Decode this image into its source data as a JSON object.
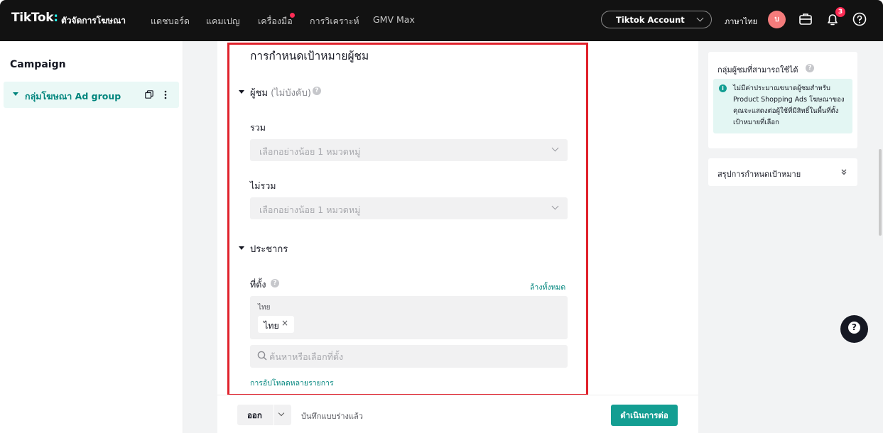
{
  "header": {
    "logo": "TikTok",
    "logo_colon": ":",
    "logo_sub": "ตัวจัดการโฆษณา",
    "nav": [
      "แดชบอร์ด",
      "แคมเปญ",
      "เครื่องมือ",
      "การวิเคราะห์",
      "GMV Max"
    ],
    "account": "Tiktok Account",
    "language": "ภาษาไทย",
    "avatar": "บ",
    "notification_count": "3"
  },
  "sidebar": {
    "title": "Campaign",
    "item_label": "กลุ่มโฆษณา Ad group"
  },
  "form": {
    "section_title": "การกำหนดเป้าหมายผู้ชม",
    "audience_heading": "ผู้ชม",
    "audience_optional": "(ไม่บังคับ)",
    "include_label": "รวม",
    "include_placeholder": "เลือกอย่างน้อย 1 หมวดหมู่",
    "exclude_label": "ไม่รวม",
    "exclude_placeholder": "เลือกอย่างน้อย 1 หมวดหมู่",
    "demographics_heading": "ประชากร",
    "location_label": "ที่ตั้ง",
    "clear_all": "ล้างทั้งหมด",
    "location_group": "ไทย",
    "location_chip": "ไทย",
    "chip_remove": "×",
    "search_placeholder": "ค้นหาหรือเลือกที่ตั้ง",
    "bulk_upload": "การอัปโหลดหลายรายการ"
  },
  "footer": {
    "exit_label": "ออก",
    "saved_note": "บันทึกแบบร่างแล้ว",
    "continue_label": "ดำเนินการต่อ"
  },
  "right_panel": {
    "audience_size_title": "กลุ่มผู้ชมที่สามารถใช้ได้",
    "info_text": "ไม่มีค่าประมาณขนาดผู้ชมสำหรับ Product Shopping Ads โฆษณาของคุณจะแสดงต่อผู้ใช้ที่มีสิทธิ์ในพื้นที่ตั้งเป้าหมายที่เลือก",
    "summary_title": "สรุปการกำหนดเป้าหมาย"
  },
  "colors": {
    "accent": "#139e92",
    "link": "#00857d",
    "highlight_border": "#e0212b",
    "badge": "#fe2c55"
  }
}
